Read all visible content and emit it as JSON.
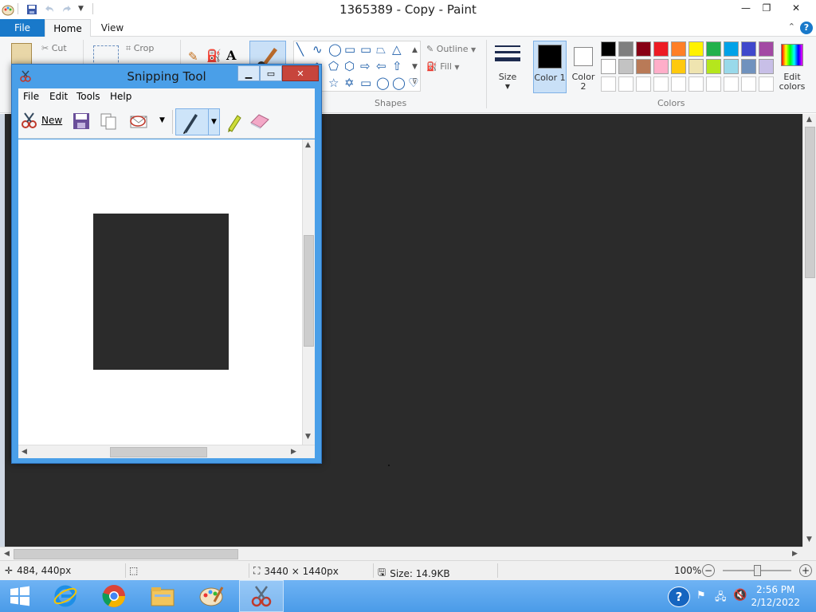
{
  "window": {
    "title": "1365389 - Copy - Paint",
    "minimize": "—",
    "restore": "❐",
    "close": "✕"
  },
  "tabs": {
    "file": "File",
    "home": "Home",
    "view": "View"
  },
  "ribbon": {
    "cut": "Cut",
    "crop": "Crop",
    "outline": "Outline",
    "fill": "Fill",
    "size": "Size",
    "color1": "Color 1",
    "color2": "Color 2",
    "edit_colors": "Edit colors",
    "shapes_label": "Shapes",
    "colors_label": "Colors",
    "shapes_row1": [
      "╲",
      "∿",
      "◯",
      "▭",
      "▭",
      "⏢",
      "△"
    ],
    "shapes_row2": [
      "◇",
      "⬠",
      "⬡",
      "⇨",
      "⇦",
      "⇧"
    ],
    "shapes_row3": [
      "☆",
      "✡",
      "▭",
      "◯",
      "◯",
      "♡"
    ],
    "palette_row1": [
      "#000000",
      "#7f7f7f",
      "#880015",
      "#ed1c24",
      "#ff7f27",
      "#fff200",
      "#22b14c",
      "#00a2e8",
      "#3f48cc",
      "#a349a4"
    ],
    "palette_row2": [
      "#ffffff",
      "#c3c3c3",
      "#b97a57",
      "#ffaec9",
      "#ffc90e",
      "#efe4b0",
      "#b5e61d",
      "#99d9ea",
      "#7092be",
      "#c8bfe7"
    ]
  },
  "snip": {
    "title": "Snipping Tool",
    "menu": {
      "file": "File",
      "edit": "Edit",
      "tools": "Tools",
      "help": "Help"
    },
    "new_label": "New"
  },
  "status": {
    "cursor": "484, 440px",
    "dimensions": "3440 × 1440px",
    "size": "Size: 14.9KB",
    "zoom": "100%",
    "zoom_level": 0.5
  },
  "taskbar": {
    "time": "2:56 PM",
    "date": "2/12/2022"
  }
}
